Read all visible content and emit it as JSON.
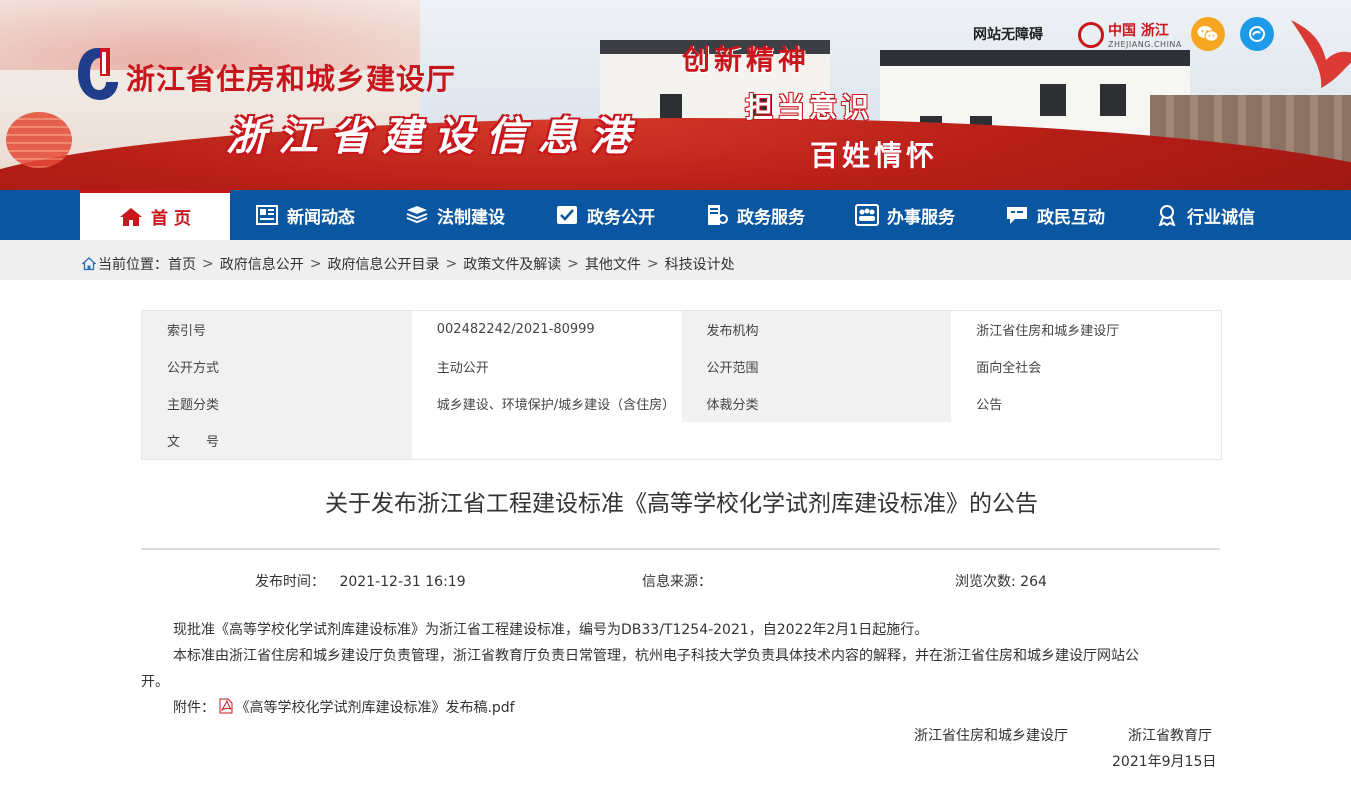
{
  "header": {
    "site_name": "浙江省住房和城乡建设厅",
    "portal_name": "浙江省建设信息港",
    "slogans": [
      "创新精神",
      "担当意识",
      "百姓情怀"
    ],
    "accessibility_label": "网站无障碍",
    "china_zhejiang_label": "中国 浙江",
    "china_zhejiang_sub": "ZHEJIANG.CHINA"
  },
  "nav": {
    "items": [
      {
        "label": "首 页",
        "icon": "home-icon"
      },
      {
        "label": "新闻动态",
        "icon": "newspaper-icon"
      },
      {
        "label": "法制建设",
        "icon": "law-books-icon"
      },
      {
        "label": "政务公开",
        "icon": "public-affairs-icon"
      },
      {
        "label": "政务服务",
        "icon": "service-icon"
      },
      {
        "label": "办事服务",
        "icon": "people-group-icon"
      },
      {
        "label": "政民互动",
        "icon": "chat-icon"
      },
      {
        "label": "行业诚信",
        "icon": "badge-icon"
      }
    ]
  },
  "breadcrumb": {
    "prefix": "当前位置：",
    "items": [
      "首页",
      "政府信息公开",
      "政府信息公开目录",
      "政策文件及解读",
      "其他文件",
      "科技设计处"
    ],
    "separator": ">"
  },
  "info": {
    "index_label": "索引号",
    "index_value": "002482242/2021-80999",
    "publisher_label": "发布机构",
    "publisher_value": "浙江省住房和城乡建设厅",
    "disclosure_label": "公开方式",
    "disclosure_value": "主动公开",
    "scope_label": "公开范围",
    "scope_value": "面向全社会",
    "topic_label": "主题分类",
    "topic_value": "城乡建设、环境保护/城乡建设（含住房）",
    "genre_label": "体裁分类",
    "genre_value": "公告",
    "docno_label": "文　　号",
    "docno_value": ""
  },
  "article": {
    "title": "关于发布浙江省工程建设标准《高等学校化学试剂库建设标准》的公告",
    "publish_time_label": "发布时间：",
    "publish_time": "2021-12-31 16:19",
    "source_label": "信息来源：",
    "source_value": "",
    "views_label": "浏览次数:",
    "views": "264",
    "paragraph1": "现批准《高等学校化学试剂库建设标准》为浙江省工程建设标准，编号为DB33/T1254-2021，自2022年2月1日起施行。",
    "paragraph2_line1": "本标准由浙江省住房和城乡建设厅负责管理，浙江省教育厅负责日常管理，杭州电子科技大学负责具体技术内容的解释，并在浙江省住房和城乡建设厅网站公",
    "paragraph2_line2": "开。",
    "attachment_label": "附件：",
    "attachment_name": "《高等学校化学试剂库建设标准》发布稿.pdf",
    "signer1": "浙江省住房和城乡建设厅",
    "signer2": "浙江省教育厅",
    "sign_date": "2021年9月15日"
  },
  "colors": {
    "primary_blue": "#0b56a0",
    "accent_red": "#c8161d",
    "label_bg": "#f1f1f1"
  }
}
